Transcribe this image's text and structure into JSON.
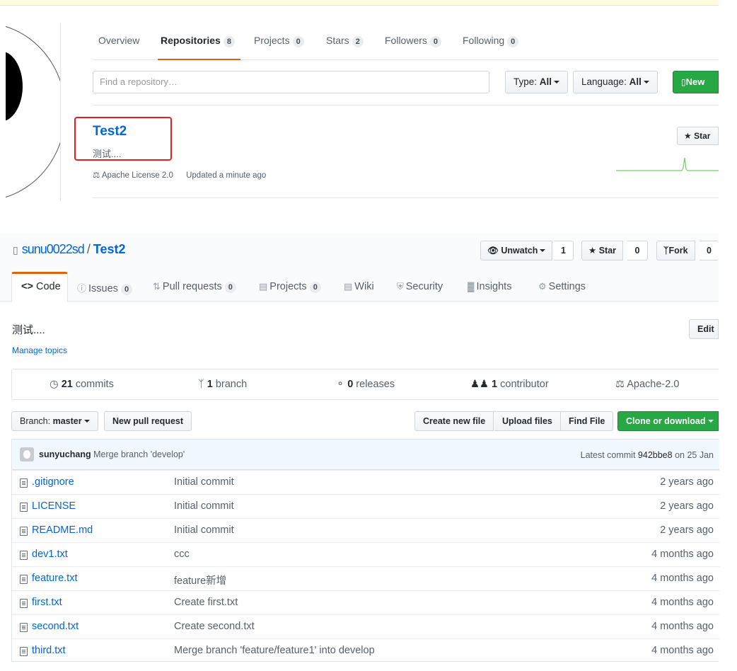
{
  "profile_tabs": [
    {
      "label": "Overview",
      "count": ""
    },
    {
      "label": "Repositories",
      "count": "8"
    },
    {
      "label": "Projects",
      "count": "0"
    },
    {
      "label": "Stars",
      "count": "2"
    },
    {
      "label": "Followers",
      "count": "0"
    },
    {
      "label": "Following",
      "count": "0"
    }
  ],
  "repo_filter": {
    "placeholder": "Find a repository…",
    "type_label": "Type:",
    "type_value": "All",
    "language_label": "Language:",
    "language_value": "All",
    "new_label": "New"
  },
  "repo_item": {
    "name": "Test2",
    "description": "测试....",
    "license": "Apache License 2.0",
    "updated": "Updated a minute ago",
    "star_label": "Star"
  },
  "repo": {
    "owner": "sunu0022sd",
    "name": "Test2",
    "watch_label": "Unwatch",
    "watch_count": "1",
    "star_label": "Star",
    "star_count": "0",
    "fork_label": "Fork",
    "fork_count": "0"
  },
  "repo_tabs": {
    "code": "Code",
    "issues": "Issues",
    "issues_count": "0",
    "pulls": "Pull requests",
    "pulls_count": "0",
    "projects": "Projects",
    "projects_count": "0",
    "wiki": "Wiki",
    "security": "Security",
    "insights": "Insights",
    "settings": "Settings"
  },
  "about": {
    "description": "测试....",
    "manage_topics": "Manage topics",
    "edit_label": "Edit"
  },
  "summary": {
    "commits_count": "21",
    "commits_label": "commits",
    "branch_count": "1",
    "branch_label": "branch",
    "releases_count": "0",
    "releases_label": "releases",
    "contributor_count": "1",
    "contributor_label": "contributor",
    "license": "Apache-2.0"
  },
  "toolbar": {
    "branch_label": "Branch:",
    "branch_value": "master",
    "new_pr": "New pull request",
    "create_file": "Create new file",
    "upload": "Upload files",
    "find_file": "Find File",
    "clone": "Clone or download"
  },
  "latest_commit": {
    "author": "sunyuchang",
    "message": "Merge branch 'develop'",
    "prefix": "Latest commit",
    "sha": "942bbe8",
    "date": "on 25 Jan"
  },
  "files": [
    {
      "name": ".gitignore",
      "message": "Initial commit",
      "age": "2 years ago"
    },
    {
      "name": "LICENSE",
      "message": "Initial commit",
      "age": "2 years ago"
    },
    {
      "name": "README.md",
      "message": "Initial commit",
      "age": "2 years ago"
    },
    {
      "name": "dev1.txt",
      "message": "ccc",
      "age": "4 months ago"
    },
    {
      "name": "feature.txt",
      "message": "feature新增",
      "age": "4 months ago"
    },
    {
      "name": "first.txt",
      "message": "Create first.txt",
      "age": "4 months ago"
    },
    {
      "name": "second.txt",
      "message": "Create second.txt",
      "age": "4 months ago"
    },
    {
      "name": "third.txt",
      "message": "Merge branch 'feature/feature1' into develop",
      "age": "4 months ago"
    }
  ],
  "colors": {
    "accent": "#0366d6",
    "green": "#28a745",
    "tab_underline": "#e36209",
    "highlight": "#e02020"
  }
}
